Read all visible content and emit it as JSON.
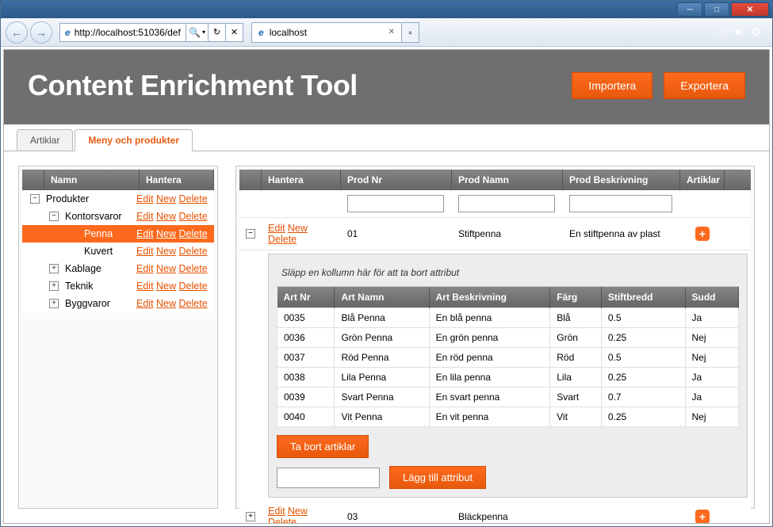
{
  "browser": {
    "url": "http://localhost:51036/def",
    "tab_title": "localhost",
    "search_icon": "🔍"
  },
  "header": {
    "title": "Content Enrichment Tool",
    "import_label": "Importera",
    "export_label": "Exportera"
  },
  "tabs": {
    "artiklar": "Artiklar",
    "meny": "Meny och produkter"
  },
  "tree": {
    "col_name": "Namn",
    "col_manage": "Hantera",
    "actions": {
      "edit": "Edit",
      "new": "New",
      "delete": "Delete"
    },
    "items": [
      {
        "label": "Produkter",
        "indent": 0,
        "expandChar": "−",
        "selected": false
      },
      {
        "label": "Kontorsvaror",
        "indent": 1,
        "expandChar": "−",
        "selected": false
      },
      {
        "label": "Penna",
        "indent": 2,
        "expandChar": "",
        "selected": true
      },
      {
        "label": "Kuvert",
        "indent": 2,
        "expandChar": "",
        "selected": false
      },
      {
        "label": "Kablage",
        "indent": 1,
        "expandChar": "+",
        "selected": false
      },
      {
        "label": "Teknik",
        "indent": 1,
        "expandChar": "+",
        "selected": false
      },
      {
        "label": "Byggvaror",
        "indent": 1,
        "expandChar": "+",
        "selected": false
      }
    ]
  },
  "main": {
    "col_manage": "Hantera",
    "col_prodnr": "Prod Nr",
    "col_prodnamn": "Prod Namn",
    "col_beskr": "Prod Beskrivning",
    "col_art": "Artiklar",
    "rows": [
      {
        "expand": "−",
        "prodnr": "01",
        "prodnamn": "Stiftpenna",
        "beskr": "En stiftpenna av plast",
        "plus": "+"
      },
      {
        "expand": "+",
        "prodnr": "03",
        "prodnamn": "Bläckpenna",
        "beskr": "",
        "plus": "+"
      }
    ],
    "actions": {
      "edit": "Edit",
      "new": "New",
      "delete": "Delete"
    }
  },
  "detail": {
    "hint": "Släpp en kollumn här för att ta bort attribut",
    "cols": {
      "artnr": "Art Nr",
      "artnamn": "Art Namn",
      "artbeskr": "Art Beskrivning",
      "farg": "Färg",
      "stiftbredd": "Stiftbredd",
      "sudd": "Sudd"
    },
    "rows": [
      {
        "artnr": "0035",
        "artnamn": "Blå Penna",
        "artbeskr": "En blå penna",
        "farg": "Blå",
        "stiftbredd": "0.5",
        "sudd": "Ja"
      },
      {
        "artnr": "0036",
        "artnamn": "Grön Penna",
        "artbeskr": "En grön penna",
        "farg": "Grön",
        "stiftbredd": "0.25",
        "sudd": "Nej"
      },
      {
        "artnr": "0037",
        "artnamn": "Röd Penna",
        "artbeskr": "En röd penna",
        "farg": "Röd",
        "stiftbredd": "0.5",
        "sudd": "Nej"
      },
      {
        "artnr": "0038",
        "artnamn": "Lila Penna",
        "artbeskr": "En lila penna",
        "farg": "Lila",
        "stiftbredd": "0.25",
        "sudd": "Ja"
      },
      {
        "artnr": "0039",
        "artnamn": "Svart Penna",
        "artbeskr": "En svart penna",
        "farg": "Svart",
        "stiftbredd": "0.7",
        "sudd": "Ja"
      },
      {
        "artnr": "0040",
        "artnamn": "Vit Penna",
        "artbeskr": "En vit penna",
        "farg": "Vit",
        "stiftbredd": "0.25",
        "sudd": "Nej"
      }
    ],
    "remove_label": "Ta bort artiklar",
    "add_attr_label": "Lägg till attribut"
  }
}
